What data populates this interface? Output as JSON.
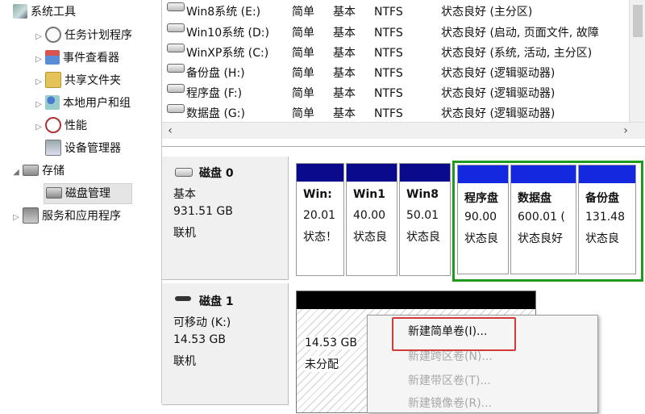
{
  "tree": {
    "system_tools": "系统工具",
    "task_scheduler": "任务计划程序",
    "event_viewer": "事件查看器",
    "shared_folders": "共享文件夹",
    "local_users": "本地用户和组",
    "performance": "性能",
    "device_manager": "设备管理器",
    "storage": "存储",
    "disk_management": "磁盘管理",
    "services_apps": "服务和应用程序"
  },
  "volumes": [
    {
      "name": "Win8系统 (E:)",
      "layout": "简单",
      "type": "基本",
      "fs": "NTFS",
      "status": "状态良好 (主分区)"
    },
    {
      "name": "Win10系统 (D:)",
      "layout": "简单",
      "type": "基本",
      "fs": "NTFS",
      "status": "状态良好 (启动, 页面文件, 故障"
    },
    {
      "name": "WinXP系统 (C:)",
      "layout": "简单",
      "type": "基本",
      "fs": "NTFS",
      "status": "状态良好 (系统, 活动, 主分区)"
    },
    {
      "name": "备份盘 (H:)",
      "layout": "简单",
      "type": "基本",
      "fs": "NTFS",
      "status": "状态良好 (逻辑驱动器)"
    },
    {
      "name": "程序盘 (F:)",
      "layout": "简单",
      "type": "基本",
      "fs": "NTFS",
      "status": "状态良好 (逻辑驱动器)"
    },
    {
      "name": "数据盘 (G:)",
      "layout": "简单",
      "type": "基本",
      "fs": "NTFS",
      "status": "状态良好 (逻辑驱动器)"
    }
  ],
  "scroll": {
    "left": "‹",
    "right": "›"
  },
  "disk0": {
    "title": "磁盘 0",
    "type": "基本",
    "size": "931.51 GB",
    "status": "联机",
    "partitions": [
      {
        "name": "Win:",
        "size": "20.01",
        "status": "状态！"
      },
      {
        "name": "Win1",
        "size": "40.00",
        "status": "状态良"
      },
      {
        "name": "Win8",
        "size": "50.01",
        "status": "状态良"
      },
      {
        "name": "程序盘",
        "size": "90.00",
        "status": "状态良"
      },
      {
        "name": "数据盘",
        "size": "600.01 (",
        "status": "状态良好"
      },
      {
        "name": "备份盘",
        "size": "131.48",
        "status": "状态良"
      }
    ]
  },
  "disk1": {
    "title": "磁盘 1",
    "type": "可移动 (K:)",
    "size": "14.53 GB",
    "status": "联机",
    "unalloc_size": "14.53 GB",
    "unalloc_label": "未分配"
  },
  "context_menu": {
    "new_simple": "新建简单卷(I)...",
    "new_spanned": "新建跨区卷(N)...",
    "new_striped": "新建带区卷(T)...",
    "new_mirrored": "新建镜像卷(R)..."
  },
  "colors": {
    "primary_bar": "#0a0a8c",
    "logical_bar": "#1428e0",
    "extended_border": "#1f9a1f",
    "unallocated_bar": "#000000",
    "highlight": "#d23a3a"
  }
}
